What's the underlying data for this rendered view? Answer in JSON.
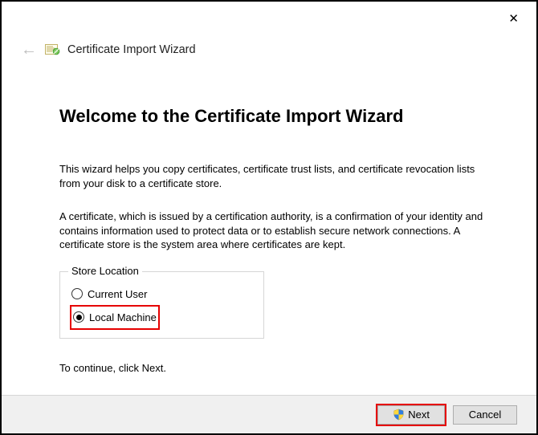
{
  "window": {
    "close_label": "✕"
  },
  "header": {
    "back_label": "←",
    "wizard_title": "Certificate Import Wizard"
  },
  "page": {
    "title": "Welcome to the Certificate Import Wizard",
    "paragraph1": "This wizard helps you copy certificates, certificate trust lists, and certificate revocation lists from your disk to a certificate store.",
    "paragraph2": "A certificate, which is issued by a certification authority, is a confirmation of your identity and contains information used to protect data or to establish secure network connections. A certificate store is the system area where certificates are kept.",
    "continue_hint": "To continue, click Next."
  },
  "store_location": {
    "legend": "Store Location",
    "options": {
      "current_user": "Current User",
      "local_machine": "Local Machine"
    },
    "selected": "local_machine"
  },
  "footer": {
    "next_label": "Next",
    "cancel_label": "Cancel"
  }
}
